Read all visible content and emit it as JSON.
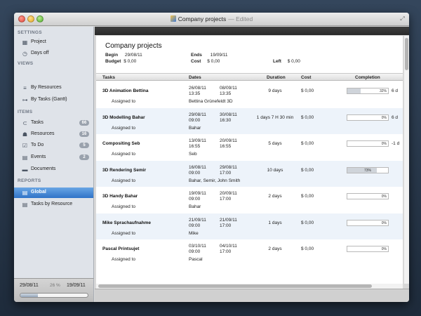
{
  "window": {
    "title": "Company projects",
    "edited": "— Edited"
  },
  "sidebar": {
    "sections": [
      {
        "label": "SETTINGS",
        "items": [
          {
            "label": "Project",
            "icon": "grid-icon"
          },
          {
            "label": "Days off",
            "icon": "clock-icon"
          }
        ]
      },
      {
        "label": "VIEWS",
        "items": [
          {
            "label": "By Resources",
            "icon": "list-icon"
          },
          {
            "label": "By Tasks (Gantt)",
            "icon": "tree-icon"
          }
        ]
      },
      {
        "label": "ITEMS",
        "items": [
          {
            "label": "Tasks",
            "icon": "tag-icon",
            "badge": "66"
          },
          {
            "label": "Resources",
            "icon": "people-icon",
            "badge": "16"
          },
          {
            "label": "To Do",
            "icon": "checkbox-icon",
            "badge": "5"
          },
          {
            "label": "Events",
            "icon": "calendar-icon",
            "badge": "2"
          },
          {
            "label": "Documents",
            "icon": "folder-icon"
          }
        ]
      },
      {
        "label": "REPORTS",
        "items": [
          {
            "label": "Global",
            "icon": "report-icon",
            "selected": true
          },
          {
            "label": "Tasks by Resource",
            "icon": "report-icon"
          }
        ]
      }
    ],
    "footer": {
      "start": "29/08/11",
      "percent": "26 %",
      "end": "19/09/11",
      "progress": 0.26
    }
  },
  "report": {
    "title": "Company projects",
    "labels": {
      "begin": "Begin",
      "ends": "Ends",
      "left": "Left",
      "budget": "Budget",
      "cost": "Cost"
    },
    "begin": "29/08/11",
    "ends": "19/09/11",
    "left": "$ 0,00",
    "budget": "$ 0,00",
    "cost": "$ 0,00",
    "columns": {
      "tasks": "Tasks",
      "dates": "Dates",
      "duration": "Duration",
      "cost": "Cost",
      "completion": "Completion"
    },
    "assigned_label": "Assigned to",
    "tasks": [
      {
        "name": "3D Animation Bettina",
        "start_date": "26/08/11",
        "start_time": "13:35",
        "end_date": "08/09/11",
        "end_time": "13:35",
        "duration": "9 days",
        "cost": "$ 0,00",
        "completion": 0.32,
        "completion_text": "32%",
        "extra": "6 d",
        "assigned": "Bettina Grünefeldt 3D"
      },
      {
        "name": "3D Modelling Bahar",
        "start_date": "29/08/11",
        "start_time": "09:00",
        "end_date": "30/08/11",
        "end_time": "16:30",
        "duration": "1 days 7 H 30 min",
        "cost": "$ 0,00",
        "completion": 0,
        "completion_text": "0%",
        "extra": "6 d",
        "assigned": "Bahar"
      },
      {
        "name": "Compositing Seb",
        "start_date": "13/09/11",
        "start_time": "16:55",
        "end_date": "20/09/11",
        "end_time": "16:55",
        "duration": "5 days",
        "cost": "$ 0,00",
        "completion": 0,
        "completion_text": "0%",
        "extra": "-1 d",
        "assigned": "Seb"
      },
      {
        "name": "3D Rendering Semir",
        "start_date": "16/08/11",
        "start_time": "09:00",
        "end_date": "29/08/11",
        "end_time": "17:00",
        "duration": "10 days",
        "cost": "$ 0,00",
        "completion": 0.73,
        "completion_text": "73%",
        "extra": "",
        "assigned": "Bahar, Semir, John Smith"
      },
      {
        "name": "3D Handy Bahar",
        "start_date": "19/09/11",
        "start_time": "09:00",
        "end_date": "20/09/11",
        "end_time": "17:00",
        "duration": "2 days",
        "cost": "$ 0,00",
        "completion": 0,
        "completion_text": "0%",
        "extra": "",
        "assigned": "Bahar"
      },
      {
        "name": "Mike Sprachaufnahme",
        "start_date": "21/09/11",
        "start_time": "09:00",
        "end_date": "21/09/11",
        "end_time": "17:00",
        "duration": "1 days",
        "cost": "$ 0,00",
        "completion": 0,
        "completion_text": "0%",
        "extra": "",
        "assigned": "Mike"
      },
      {
        "name": "Pascal Printsujet",
        "start_date": "03/10/11",
        "start_time": "09:00",
        "end_date": "04/10/11",
        "end_time": "17:00",
        "duration": "2 days",
        "cost": "$ 0,00",
        "completion": 0,
        "completion_text": "0%",
        "extra": "",
        "assigned": "Pascal"
      }
    ]
  }
}
